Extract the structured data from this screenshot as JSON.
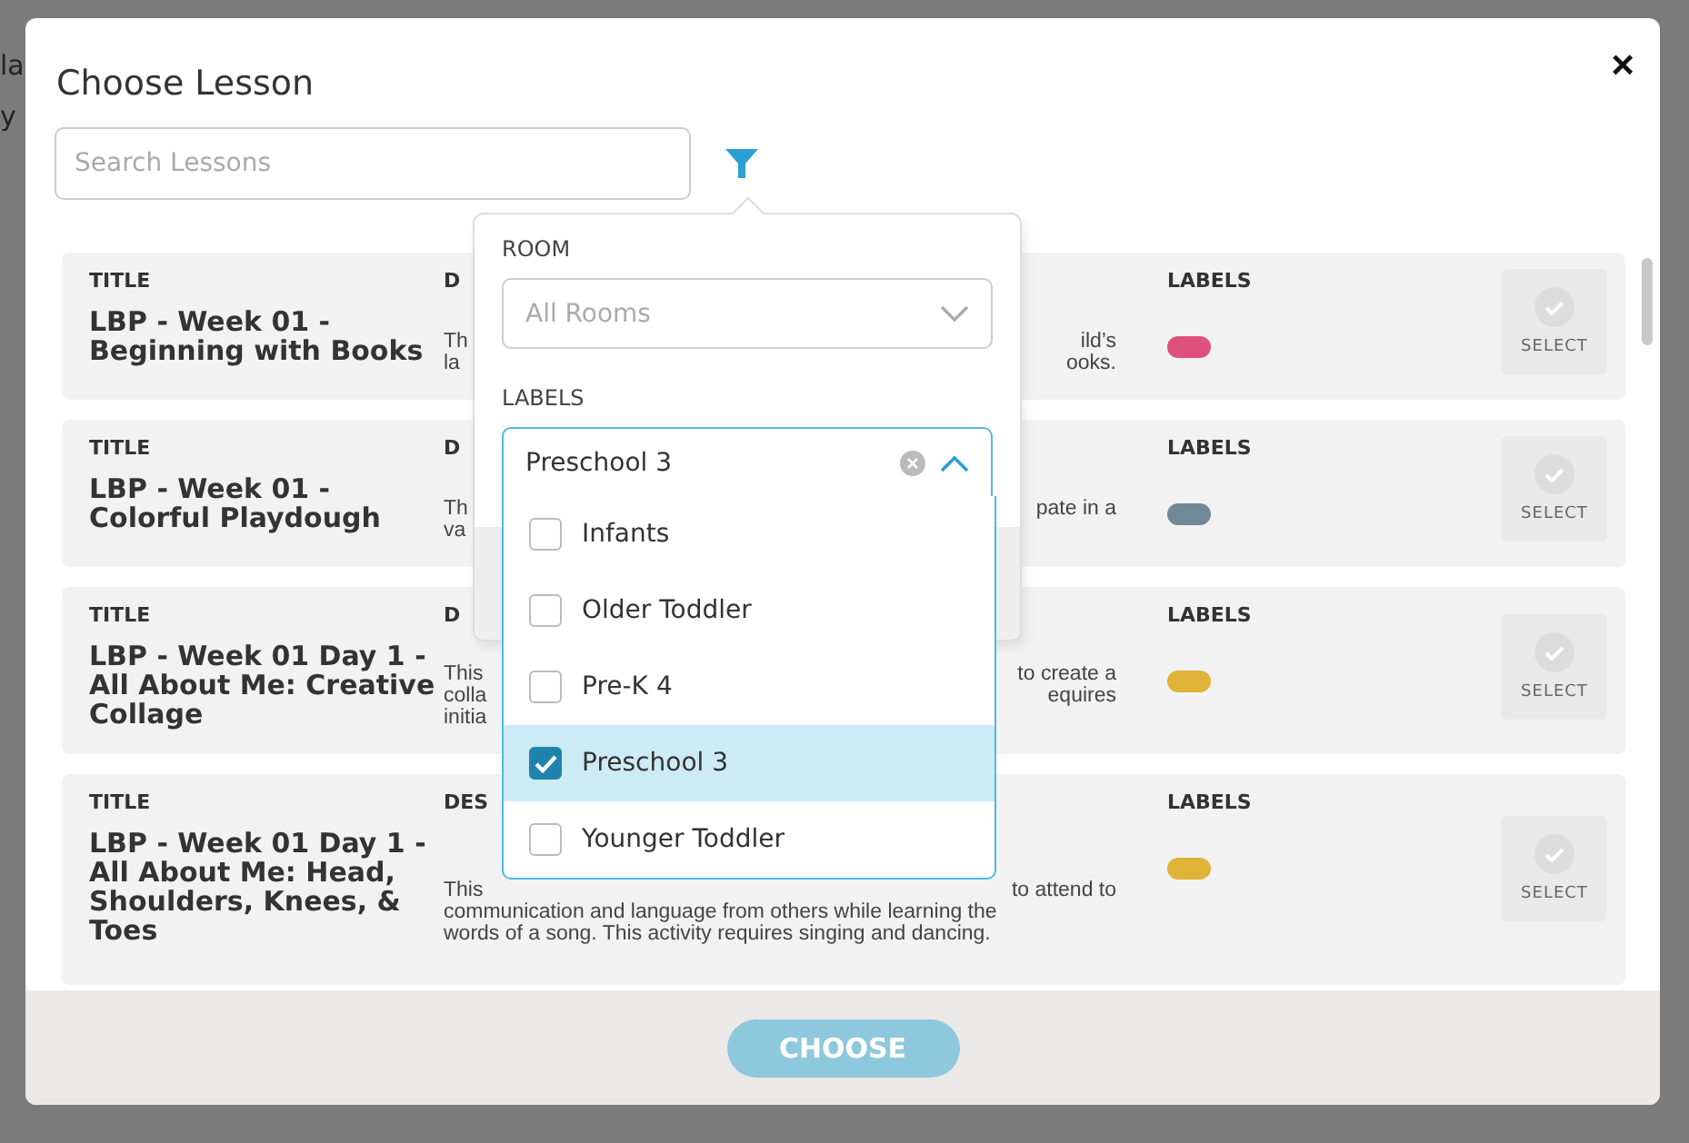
{
  "backdrop": {
    "fragments": [
      "la",
      "y"
    ]
  },
  "dialog": {
    "title": "Choose Lesson",
    "close": "×"
  },
  "search": {
    "placeholder": "Search Lessons"
  },
  "lessons": [
    {
      "title_label": "TITLE",
      "title": "LBP - Week 01 - Beginning with Books",
      "desc_label": "D",
      "desc_lines": [
        {
          "start": "Th",
          "end": "ild’s"
        },
        {
          "start": "la",
          "end": "ooks."
        }
      ],
      "labels_label": "LABELS",
      "color": "#e0507f",
      "select": "SELECT"
    },
    {
      "title_label": "TITLE",
      "title": "LBP - Week 01 - Colorful Playdough",
      "desc_label": "D",
      "desc_lines": [
        {
          "start": "Th",
          "end": "pate in a"
        },
        {
          "start": "va"
        }
      ],
      "labels_label": "LABELS",
      "color": "#718896",
      "select": "SELECT"
    },
    {
      "title_label": "TITLE",
      "title": "LBP - Week 01 Day 1 - All About Me: Creative Collage",
      "desc_label": "D",
      "desc_lines": [
        {
          "start": "This",
          "end": "to create a"
        },
        {
          "start": "colla",
          "end": "equires"
        },
        {
          "start": "initia"
        }
      ],
      "labels_label": "LABELS",
      "color": "#dfb338",
      "select": "SELECT"
    },
    {
      "title_label": "TITLE",
      "title": "LBP - Week 01 Day 1 - All About Me: Head, Shoulders, Knees, & Toes",
      "desc_label": "DES",
      "desc_lines": [
        {
          "start": "This",
          "end": "to attend to"
        },
        {
          "start": "communication and language from others while learning the"
        },
        {
          "start": "words of a song. This activity requires singing and dancing."
        }
      ],
      "labels_label": "LABELS",
      "color": "#dfb338",
      "select": "SELECT"
    }
  ],
  "filter": {
    "room_label": "ROOM",
    "room_placeholder": "All Rooms",
    "labels_label": "LABELS",
    "labels_value": "Preschool 3",
    "expanded": true,
    "options": [
      {
        "label": "Infants",
        "checked": false,
        "selected": false
      },
      {
        "label": "Older Toddler",
        "checked": false,
        "selected": false
      },
      {
        "label": "Pre-K 4",
        "checked": false,
        "selected": false
      },
      {
        "label": "Preschool 3",
        "checked": true,
        "selected": true
      },
      {
        "label": "Younger Toddler",
        "checked": false,
        "selected": false
      }
    ]
  },
  "footer": {
    "button": "CHOOSE"
  }
}
